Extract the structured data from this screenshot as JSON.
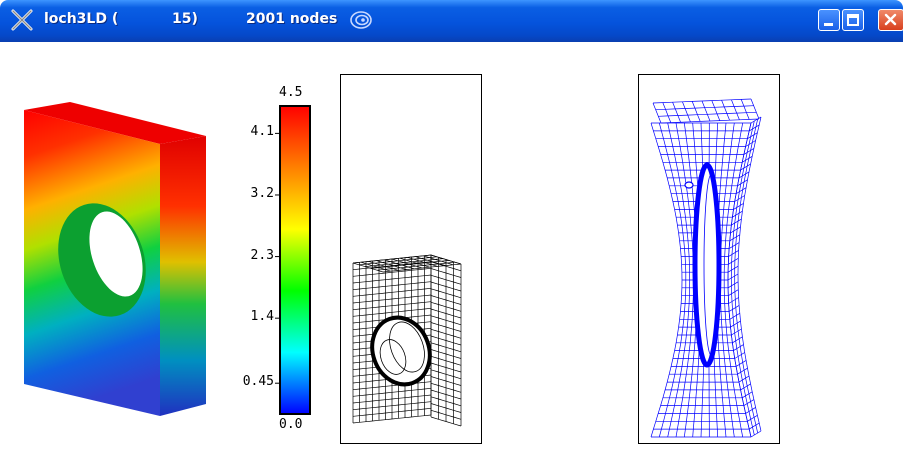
{
  "window": {
    "title_parts": [
      "loch3LD (",
      "15)",
      "2001 nodes"
    ],
    "icons": {
      "app": "x-window-icon",
      "title_extra": "swirl-icon",
      "minimize": "minimize-icon",
      "maximize": "maximize-icon",
      "close": "close-icon"
    },
    "colors": {
      "titlebar": "#0553dc",
      "mesh_left": "#000000",
      "mesh_right": "#0000ff"
    }
  },
  "colorbar": {
    "max_label": "4.5",
    "min_label": "0.0",
    "tick_labels": [
      "4.1",
      "3.2",
      "2.3",
      "1.4",
      "0.45"
    ],
    "tick_values": [
      4.1,
      3.2,
      2.3,
      1.4,
      0.45
    ],
    "min_value": 0.0,
    "max_value": 4.5,
    "gradient": [
      "#ff0000",
      "#ff8000",
      "#ffff00",
      "#00ff00",
      "#00ffff",
      "#0000ff"
    ]
  }
}
